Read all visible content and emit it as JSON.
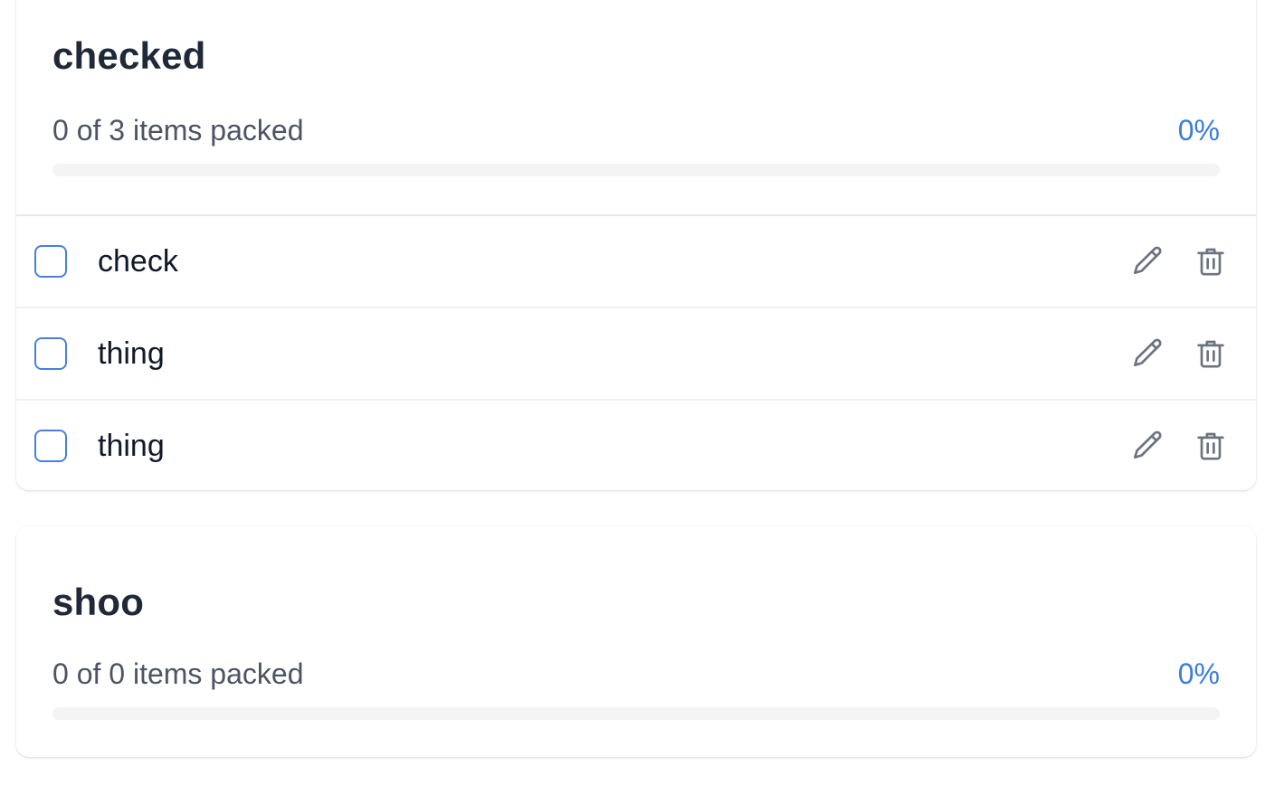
{
  "colors": {
    "accent": "#3b7ddd",
    "title": "#1f2937",
    "muted": "#4b5563",
    "icon": "#6b7280",
    "track": "#f3f4f3"
  },
  "categories": [
    {
      "title": "checked",
      "progress_text": "0 of 3 items packed",
      "progress_percent": "0%",
      "progress_fraction": 0,
      "items": [
        {
          "label": "check",
          "checked": false,
          "edit_icon": "pencil-icon",
          "delete_icon": "trash-icon"
        },
        {
          "label": "thing",
          "checked": false,
          "edit_icon": "pencil-icon",
          "delete_icon": "trash-icon"
        },
        {
          "label": "thing",
          "checked": false,
          "edit_icon": "pencil-icon",
          "delete_icon": "trash-icon"
        }
      ]
    },
    {
      "title": "shoo",
      "progress_text": "0 of 0 items packed",
      "progress_percent": "0%",
      "progress_fraction": 0,
      "items": []
    }
  ]
}
